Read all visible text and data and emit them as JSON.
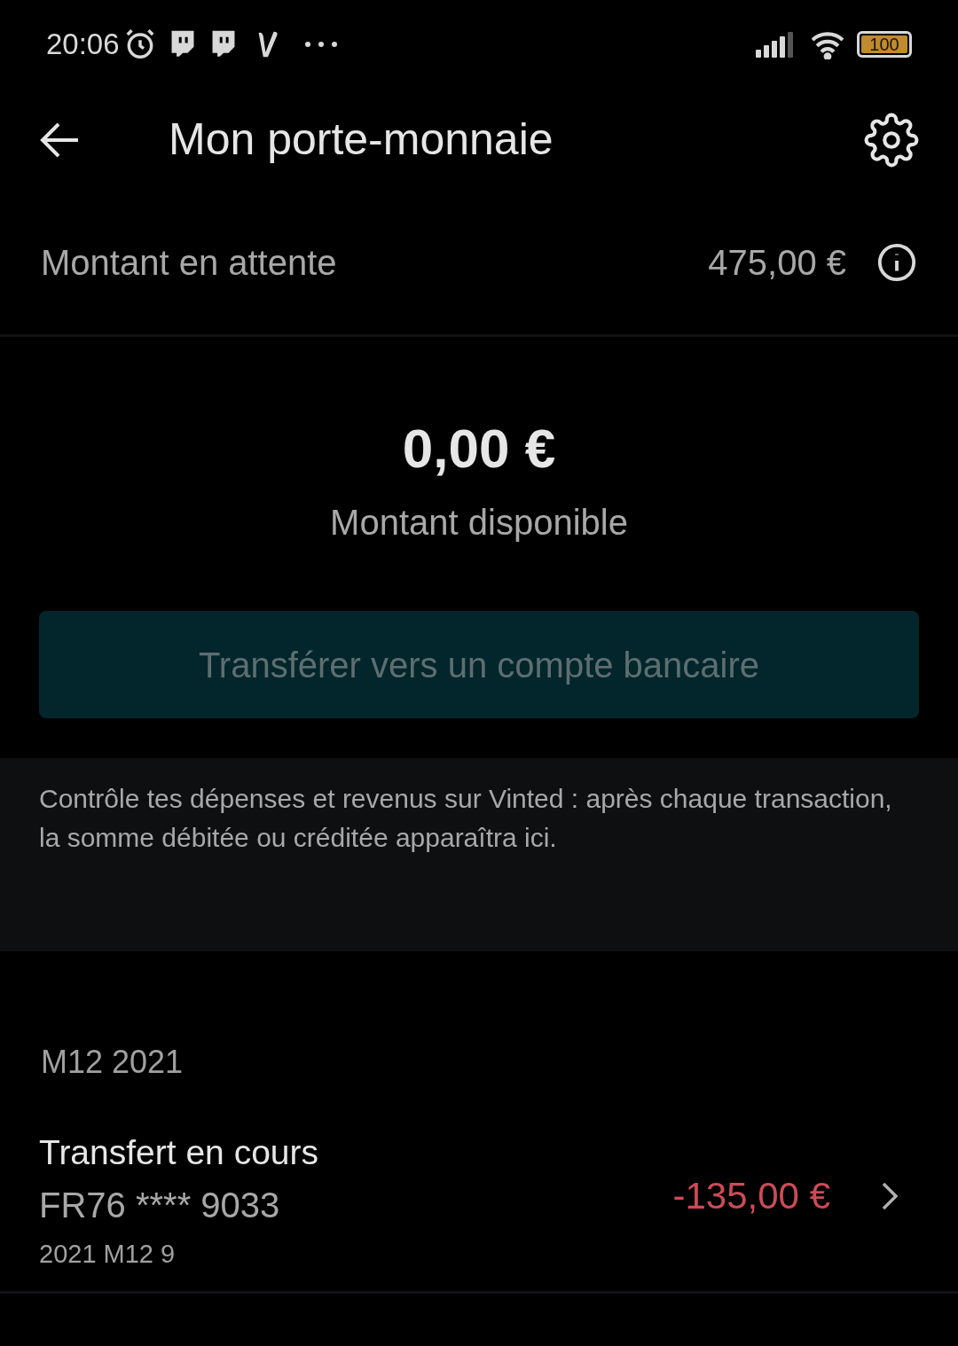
{
  "status_bar": {
    "time": "20:06",
    "battery": "100"
  },
  "header": {
    "title": "Mon porte-monnaie"
  },
  "pending": {
    "label": "Montant en attente",
    "amount": "475,00 €"
  },
  "balance": {
    "amount": "0,00 €",
    "label": "Montant disponible"
  },
  "transfer_button": {
    "label": "Transférer vers un compte bancaire",
    "disabled": true
  },
  "info": {
    "text": "Contrôle tes dépenses et revenus sur Vinted : après chaque transaction, la somme débitée ou créditée apparaîtra ici."
  },
  "sections": [
    {
      "heading": "M12 2021",
      "transactions": [
        {
          "title": "Transfert en cours",
          "account": "FR76 **** 9033",
          "date": "2021 M12 9",
          "amount": "-135,00 €",
          "kind": "debit"
        }
      ]
    }
  ]
}
